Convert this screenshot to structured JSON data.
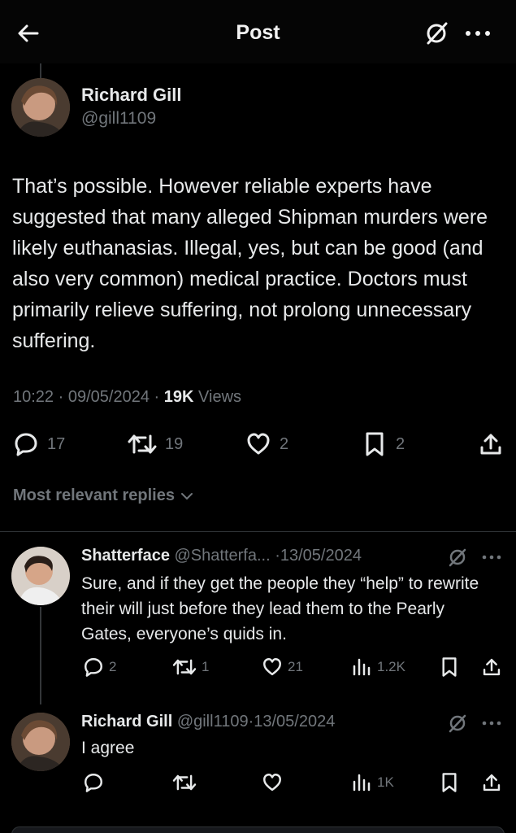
{
  "header": {
    "title": "Post",
    "back_icon": "arrow-left-icon",
    "grok_icon": "grok-icon",
    "more_icon": "more-horizontal-icon"
  },
  "post": {
    "author_name": "Richard Gill",
    "author_handle": "@gill1109",
    "text": "That’s possible. However reliable experts have suggested that many alleged Shipman murders were likely euthanasias. Illegal, yes, but can be good (and also very common) medical practice. Doctors must primarily relieve suffering, not prolong unnecessary suffering.",
    "time": "10:22",
    "date": "09/05/2024",
    "views_count": "19K",
    "views_label": "Views",
    "replies": "17",
    "reposts": "19",
    "likes": "2",
    "bookmarks": "2"
  },
  "replies_filter": "Most relevant replies",
  "replies": [
    {
      "name": "Shatterface",
      "handle": "@Shatterfa...",
      "date": "13/05/2024",
      "text": "Sure, and if they get the people they “help” to rewrite their will just before they lead them to the Pearly Gates, everyone’s quids in.",
      "replies": "2",
      "reposts": "1",
      "likes": "21",
      "views": "1.2K"
    },
    {
      "name": "Richard Gill",
      "handle": "@gill1109",
      "date": "13/05/2024",
      "text": "I agree",
      "replies": "",
      "reposts": "",
      "likes": "",
      "views": "1K"
    }
  ],
  "separator": "·",
  "colors": {
    "background": "#000000",
    "text": "#e7e9ea",
    "muted": "#71767b",
    "divider": "#2f3336"
  }
}
